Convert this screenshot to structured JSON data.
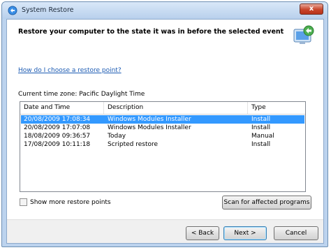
{
  "window": {
    "title": "System Restore",
    "close_label": "x"
  },
  "header": {
    "text": "Restore your computer to the state it was in before the selected event"
  },
  "help_link": "How do I choose a restore point?",
  "timezone_text": "Current time zone: Pacific Daylight Time",
  "list": {
    "columns": [
      "Date and Time",
      "Description",
      "Type"
    ],
    "rows": [
      {
        "date": "20/08/2009 17:08:34",
        "description": "Windows Modules Installer",
        "type": "Install",
        "selected": true
      },
      {
        "date": "20/08/2009 17:07:08",
        "description": "Windows Modules Installer",
        "type": "Install",
        "selected": false
      },
      {
        "date": "18/08/2009 09:36:57",
        "description": "Today",
        "type": "Manual",
        "selected": false
      },
      {
        "date": "17/08/2009 10:11:18",
        "description": "Scripted restore",
        "type": "Install",
        "selected": false
      }
    ]
  },
  "show_more": {
    "label": "Show more restore points",
    "checked": false
  },
  "buttons": {
    "scan": "Scan for affected programs",
    "back": "< Back",
    "next": "Next >",
    "cancel": "Cancel"
  },
  "colors": {
    "selection": "#3399ff",
    "link": "#1c5bb3",
    "frame": "#bcd3ee"
  }
}
